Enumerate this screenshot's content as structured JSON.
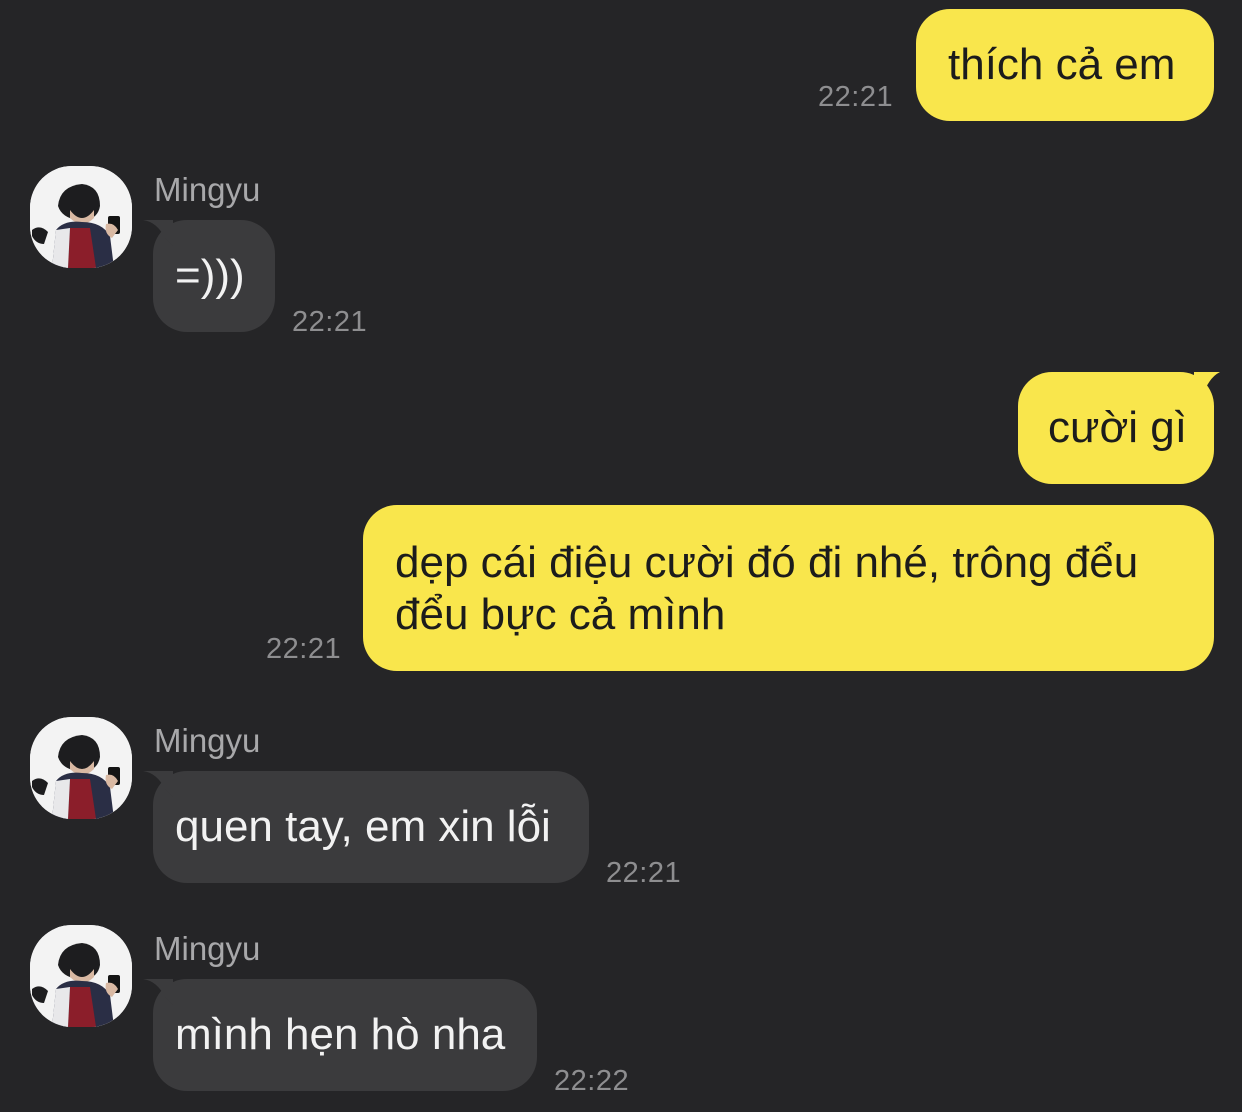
{
  "colors": {
    "background": "#252527",
    "outgoing_bubble": "#f9e64c",
    "incoming_bubble": "#3b3b3d",
    "timestamp": "#8e8e90",
    "sender_name": "#a8a8aa"
  },
  "messages": [
    {
      "direction": "outgoing",
      "text": "thích cả em",
      "time": "22:21"
    },
    {
      "direction": "incoming",
      "sender": "Mingyu",
      "text": "=)))",
      "time": "22:21"
    },
    {
      "direction": "outgoing",
      "text": "cười gì"
    },
    {
      "direction": "outgoing",
      "text_line1": "dẹp cái điệu cười đó đi nhé, trông đểu",
      "text_line2": "đểu bực cả mình",
      "time": "22:21"
    },
    {
      "direction": "incoming",
      "sender": "Mingyu",
      "text": "quen tay, em xin lỗi",
      "time": "22:21"
    },
    {
      "direction": "incoming",
      "sender": "Mingyu",
      "text": "mình hẹn hò nha",
      "time": "22:22"
    }
  ],
  "icons": {
    "avatar": "user-avatar-photo"
  }
}
